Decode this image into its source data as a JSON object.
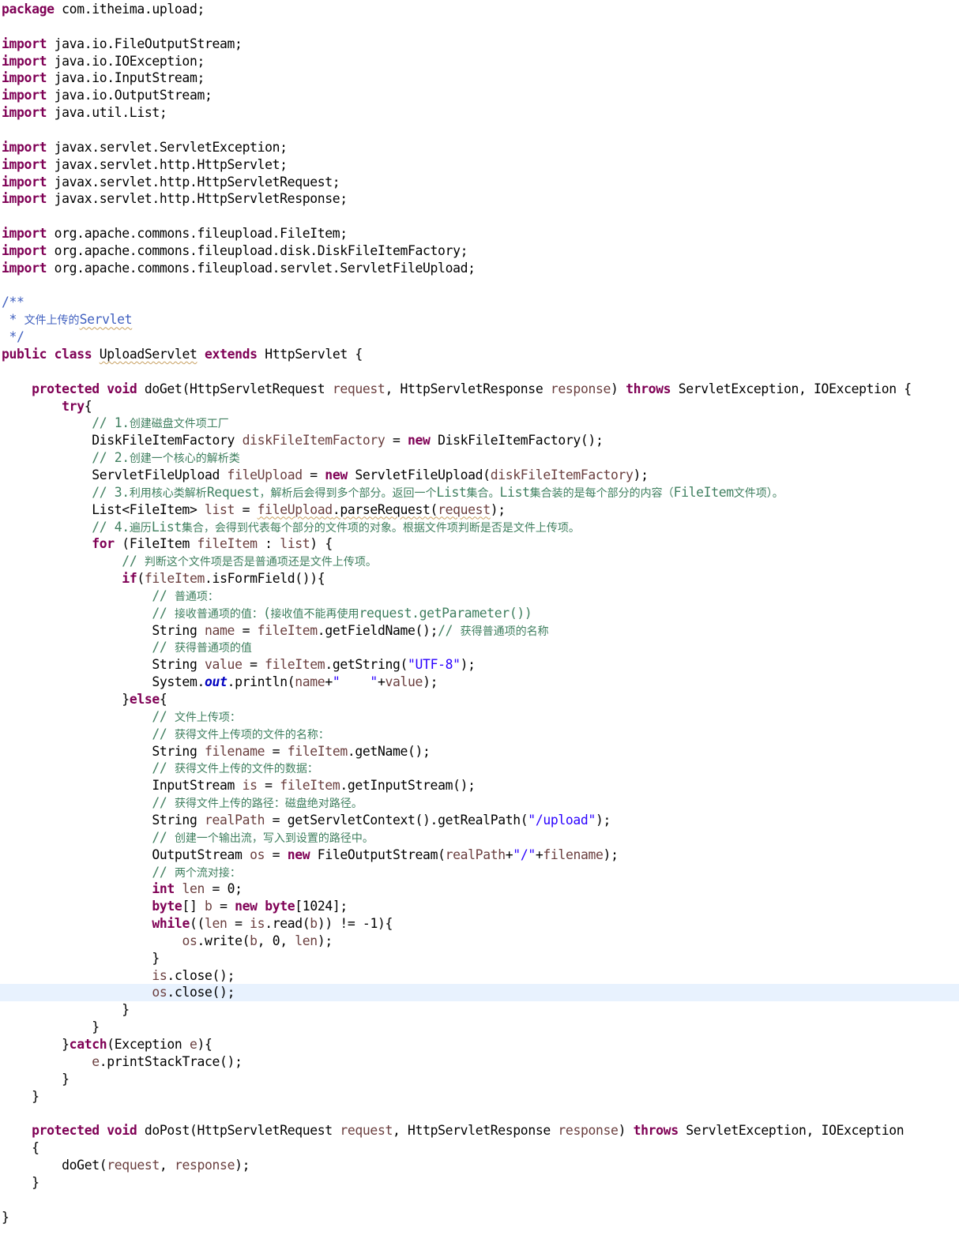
{
  "editor": {
    "lines": [
      [
        [
          "k",
          "package"
        ],
        [
          "p",
          " com.itheima.upload;"
        ]
      ],
      [],
      [
        [
          "k",
          "import"
        ],
        [
          "p",
          " java.io.FileOutputStream;"
        ]
      ],
      [
        [
          "k",
          "import"
        ],
        [
          "p",
          " java.io.IOException;"
        ]
      ],
      [
        [
          "k",
          "import"
        ],
        [
          "p",
          " java.io.InputStream;"
        ]
      ],
      [
        [
          "k",
          "import"
        ],
        [
          "p",
          " java.io.OutputStream;"
        ]
      ],
      [
        [
          "k",
          "import"
        ],
        [
          "p",
          " java.util.List;"
        ]
      ],
      [],
      [
        [
          "k",
          "import"
        ],
        [
          "p",
          " javax.servlet.ServletException;"
        ]
      ],
      [
        [
          "k",
          "import"
        ],
        [
          "p",
          " javax.servlet.http.HttpServlet;"
        ]
      ],
      [
        [
          "k",
          "import"
        ],
        [
          "p",
          " javax.servlet.http.HttpServletRequest;"
        ]
      ],
      [
        [
          "k",
          "import"
        ],
        [
          "p",
          " javax.servlet.http.HttpServletResponse;"
        ]
      ],
      [],
      [
        [
          "k",
          "import"
        ],
        [
          "p",
          " org.apache.commons.fileupload.FileItem;"
        ]
      ],
      [
        [
          "k",
          "import"
        ],
        [
          "p",
          " org.apache.commons.fileupload.disk.DiskFileItemFactory;"
        ]
      ],
      [
        [
          "k",
          "import"
        ],
        [
          "p",
          " org.apache.commons.fileupload.servlet.ServletFileUpload;"
        ]
      ],
      [],
      [
        [
          "d",
          "/**"
        ]
      ],
      [
        [
          "d",
          " * "
        ],
        [
          "dn",
          "文件上传的"
        ],
        [
          "dw",
          "Servlet"
        ]
      ],
      [
        [
          "d",
          " */"
        ]
      ],
      [
        [
          "k",
          "public"
        ],
        [
          "p",
          " "
        ],
        [
          "k",
          "class"
        ],
        [
          "p",
          " "
        ],
        [
          "pw",
          "UploadServlet"
        ],
        [
          "p",
          " "
        ],
        [
          "k",
          "extends"
        ],
        [
          "p",
          " HttpServlet {"
        ]
      ],
      [],
      [
        [
          "p",
          "    "
        ],
        [
          "k",
          "protected"
        ],
        [
          "p",
          " "
        ],
        [
          "k",
          "void"
        ],
        [
          "p",
          " doGet(HttpServletRequest "
        ],
        [
          "v",
          "request"
        ],
        [
          "p",
          ", HttpServletResponse "
        ],
        [
          "v",
          "response"
        ],
        [
          "p",
          ") "
        ],
        [
          "k",
          "throws"
        ],
        [
          "p",
          " ServletException, IOException {"
        ]
      ],
      [
        [
          "p",
          "        "
        ],
        [
          "k",
          "try"
        ],
        [
          "p",
          "{"
        ]
      ],
      [
        [
          "p",
          "            "
        ],
        [
          "c",
          "// 1."
        ],
        [
          "cn",
          "创建磁盘文件项工厂"
        ]
      ],
      [
        [
          "p",
          "            DiskFileItemFactory "
        ],
        [
          "v",
          "diskFileItemFactory"
        ],
        [
          "p",
          " = "
        ],
        [
          "k",
          "new"
        ],
        [
          "p",
          " DiskFileItemFactory();"
        ]
      ],
      [
        [
          "p",
          "            "
        ],
        [
          "c",
          "// 2."
        ],
        [
          "cn",
          "创建一个核心的解析类"
        ]
      ],
      [
        [
          "p",
          "            ServletFileUpload "
        ],
        [
          "v",
          "fileUpload"
        ],
        [
          "p",
          " = "
        ],
        [
          "k",
          "new"
        ],
        [
          "p",
          " ServletFileUpload("
        ],
        [
          "v",
          "diskFileItemFactory"
        ],
        [
          "p",
          ");"
        ]
      ],
      [
        [
          "p",
          "            "
        ],
        [
          "c",
          "// 3."
        ],
        [
          "cn",
          "利用核心类解析"
        ],
        [
          "c",
          "Request"
        ],
        [
          "cn",
          "，解析后会得到多个部分。返回一个"
        ],
        [
          "c",
          "List"
        ],
        [
          "cn",
          "集合。"
        ],
        [
          "c",
          "List"
        ],
        [
          "cn",
          "集合装的是每个部分的内容（"
        ],
        [
          "c",
          "FileItem"
        ],
        [
          "cn",
          "文件项）。"
        ]
      ],
      [
        [
          "p",
          "            List<FileItem> "
        ],
        [
          "v",
          "list"
        ],
        [
          "p",
          " = "
        ],
        [
          "vw",
          "fileUpload"
        ],
        [
          "pw",
          ".parseRequest("
        ],
        [
          "vw",
          "request"
        ],
        [
          "p",
          ");"
        ]
      ],
      [
        [
          "p",
          "            "
        ],
        [
          "c",
          "// 4."
        ],
        [
          "cn",
          "遍历"
        ],
        [
          "c",
          "List"
        ],
        [
          "cn",
          "集合，会得到代表每个部分的文件项的对象。根据文件项判断是否是文件上传项。"
        ]
      ],
      [
        [
          "p",
          "            "
        ],
        [
          "k",
          "for"
        ],
        [
          "p",
          " (FileItem "
        ],
        [
          "v",
          "fileItem"
        ],
        [
          "p",
          " : "
        ],
        [
          "v",
          "list"
        ],
        [
          "p",
          ") {"
        ]
      ],
      [
        [
          "p",
          "                "
        ],
        [
          "c",
          "// "
        ],
        [
          "cn",
          "判断这个文件项是否是普通项还是文件上传项。"
        ]
      ],
      [
        [
          "p",
          "                "
        ],
        [
          "k",
          "if"
        ],
        [
          "p",
          "("
        ],
        [
          "v",
          "fileItem"
        ],
        [
          "p",
          ".isFormField()){"
        ]
      ],
      [
        [
          "p",
          "                    "
        ],
        [
          "c",
          "// "
        ],
        [
          "cn",
          "普通项："
        ]
      ],
      [
        [
          "p",
          "                    "
        ],
        [
          "c",
          "// "
        ],
        [
          "cn",
          "接收普通项的值："
        ],
        [
          "c",
          "("
        ],
        [
          "cn",
          "接收值不能再使用"
        ],
        [
          "c",
          "request.getParameter())"
        ]
      ],
      [
        [
          "p",
          "                    String "
        ],
        [
          "v",
          "name"
        ],
        [
          "p",
          " = "
        ],
        [
          "v",
          "fileItem"
        ],
        [
          "p",
          ".getFieldName();"
        ],
        [
          "c",
          "// "
        ],
        [
          "cn",
          "获得普通项的名称"
        ]
      ],
      [
        [
          "p",
          "                    "
        ],
        [
          "c",
          "// "
        ],
        [
          "cn",
          "获得普通项的值"
        ]
      ],
      [
        [
          "p",
          "                    String "
        ],
        [
          "v",
          "value"
        ],
        [
          "p",
          " = "
        ],
        [
          "v",
          "fileItem"
        ],
        [
          "p",
          ".getString("
        ],
        [
          "s",
          "\"UTF-8\""
        ],
        [
          "p",
          ");"
        ]
      ],
      [
        [
          "p",
          "                    System."
        ],
        [
          "f",
          "out"
        ],
        [
          "p",
          ".println("
        ],
        [
          "v",
          "name"
        ],
        [
          "p",
          "+"
        ],
        [
          "s",
          "\"    \""
        ],
        [
          "p",
          "+"
        ],
        [
          "v",
          "value"
        ],
        [
          "p",
          ");"
        ]
      ],
      [
        [
          "p",
          "                }"
        ],
        [
          "k",
          "else"
        ],
        [
          "p",
          "{"
        ]
      ],
      [
        [
          "p",
          "                    "
        ],
        [
          "c",
          "// "
        ],
        [
          "cn",
          "文件上传项："
        ]
      ],
      [
        [
          "p",
          "                    "
        ],
        [
          "c",
          "// "
        ],
        [
          "cn",
          "获得文件上传项的文件的名称："
        ]
      ],
      [
        [
          "p",
          "                    String "
        ],
        [
          "v",
          "filename"
        ],
        [
          "p",
          " = "
        ],
        [
          "v",
          "fileItem"
        ],
        [
          "p",
          ".getName();"
        ]
      ],
      [
        [
          "p",
          "                    "
        ],
        [
          "c",
          "// "
        ],
        [
          "cn",
          "获得文件上传的文件的数据："
        ]
      ],
      [
        [
          "p",
          "                    InputStream "
        ],
        [
          "v",
          "is"
        ],
        [
          "p",
          " = "
        ],
        [
          "v",
          "fileItem"
        ],
        [
          "p",
          ".getInputStream();"
        ]
      ],
      [
        [
          "p",
          "                    "
        ],
        [
          "c",
          "// "
        ],
        [
          "cn",
          "获得文件上传的路径：磁盘绝对路径。"
        ]
      ],
      [
        [
          "p",
          "                    String "
        ],
        [
          "v",
          "realPath"
        ],
        [
          "p",
          " = getServletContext().getRealPath("
        ],
        [
          "s",
          "\"/upload\""
        ],
        [
          "p",
          ");"
        ]
      ],
      [
        [
          "p",
          "                    "
        ],
        [
          "c",
          "// "
        ],
        [
          "cn",
          "创建一个输出流，写入到设置的路径中。"
        ]
      ],
      [
        [
          "p",
          "                    OutputStream "
        ],
        [
          "v",
          "os"
        ],
        [
          "p",
          " = "
        ],
        [
          "k",
          "new"
        ],
        [
          "p",
          " FileOutputStream("
        ],
        [
          "v",
          "realPath"
        ],
        [
          "p",
          "+"
        ],
        [
          "s",
          "\"/\""
        ],
        [
          "p",
          "+"
        ],
        [
          "v",
          "filename"
        ],
        [
          "p",
          ");"
        ]
      ],
      [
        [
          "p",
          "                    "
        ],
        [
          "c",
          "// "
        ],
        [
          "cn",
          "两个流对接："
        ]
      ],
      [
        [
          "p",
          "                    "
        ],
        [
          "k",
          "int"
        ],
        [
          "p",
          " "
        ],
        [
          "v",
          "len"
        ],
        [
          "p",
          " = 0;"
        ]
      ],
      [
        [
          "p",
          "                    "
        ],
        [
          "k",
          "byte"
        ],
        [
          "p",
          "[] "
        ],
        [
          "v",
          "b"
        ],
        [
          "p",
          " = "
        ],
        [
          "k",
          "new"
        ],
        [
          "p",
          " "
        ],
        [
          "k",
          "byte"
        ],
        [
          "p",
          "[1024];"
        ]
      ],
      [
        [
          "p",
          "                    "
        ],
        [
          "k",
          "while"
        ],
        [
          "p",
          "(("
        ],
        [
          "v",
          "len"
        ],
        [
          "p",
          " = "
        ],
        [
          "v",
          "is"
        ],
        [
          "p",
          ".read("
        ],
        [
          "v",
          "b"
        ],
        [
          "p",
          ")) != -1){"
        ]
      ],
      [
        [
          "p",
          "                        "
        ],
        [
          "v",
          "os"
        ],
        [
          "p",
          ".write("
        ],
        [
          "v",
          "b"
        ],
        [
          "p",
          ", 0, "
        ],
        [
          "v",
          "len"
        ],
        [
          "p",
          ");"
        ]
      ],
      [
        [
          "p",
          "                    }"
        ]
      ],
      [
        [
          "p",
          "                    "
        ],
        [
          "v",
          "is"
        ],
        [
          "p",
          ".close();"
        ]
      ],
      [
        [
          "p",
          "                    "
        ],
        [
          "v",
          "os"
        ],
        [
          "p",
          ".close();"
        ]
      ],
      [
        [
          "p",
          "                }"
        ]
      ],
      [
        [
          "p",
          "            }"
        ]
      ],
      [
        [
          "p",
          "        }"
        ],
        [
          "k",
          "catch"
        ],
        [
          "p",
          "(Exception "
        ],
        [
          "v",
          "e"
        ],
        [
          "p",
          "){"
        ]
      ],
      [
        [
          "p",
          "            "
        ],
        [
          "v",
          "e"
        ],
        [
          "p",
          ".printStackTrace();"
        ]
      ],
      [
        [
          "p",
          "        }"
        ]
      ],
      [
        [
          "p",
          "    }"
        ]
      ],
      [],
      [
        [
          "p",
          "    "
        ],
        [
          "k",
          "protected"
        ],
        [
          "p",
          " "
        ],
        [
          "k",
          "void"
        ],
        [
          "p",
          " doPost(HttpServletRequest "
        ],
        [
          "v",
          "request"
        ],
        [
          "p",
          ", HttpServletResponse "
        ],
        [
          "v",
          "response"
        ],
        [
          "p",
          ") "
        ],
        [
          "k",
          "throws"
        ],
        [
          "p",
          " ServletException, IOException"
        ]
      ],
      [
        [
          "p",
          "    {"
        ]
      ],
      [
        [
          "p",
          "        doGet("
        ],
        [
          "v",
          "request"
        ],
        [
          "p",
          ", "
        ],
        [
          "v",
          "response"
        ],
        [
          "p",
          ");"
        ]
      ],
      [
        [
          "p",
          "    }"
        ]
      ],
      [],
      [
        [
          "p",
          "}"
        ]
      ]
    ],
    "current_line_index": 57
  }
}
